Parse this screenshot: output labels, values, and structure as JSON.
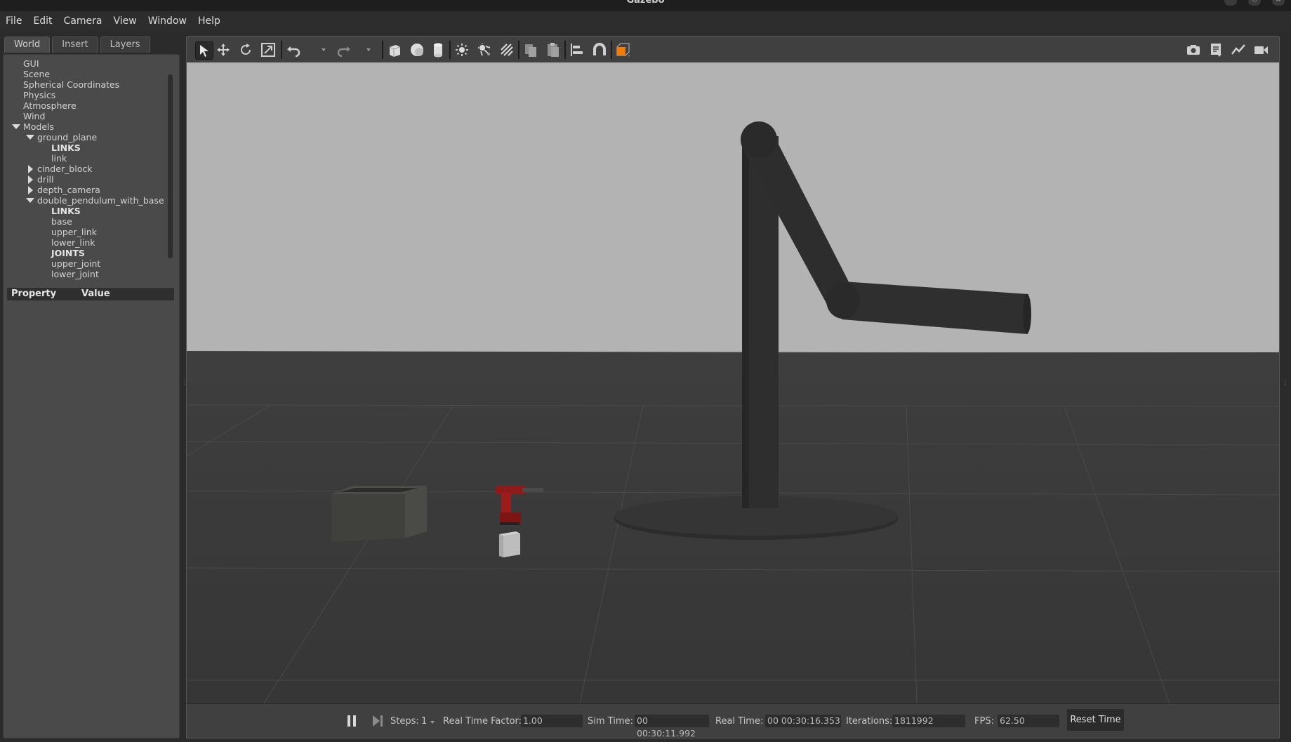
{
  "window": {
    "title": "Gazebo"
  },
  "menubar": [
    "File",
    "Edit",
    "Camera",
    "View",
    "Window",
    "Help"
  ],
  "left_panel": {
    "tabs": [
      {
        "label": "World",
        "active": true
      },
      {
        "label": "Insert",
        "active": false
      },
      {
        "label": "Layers",
        "active": false
      }
    ],
    "tree": [
      {
        "label": "GUI",
        "level": 1,
        "bold": false,
        "arrow": ""
      },
      {
        "label": "Scene",
        "level": 1,
        "bold": false,
        "arrow": ""
      },
      {
        "label": "Spherical Coordinates",
        "level": 1,
        "bold": false,
        "arrow": ""
      },
      {
        "label": "Physics",
        "level": 1,
        "bold": false,
        "arrow": ""
      },
      {
        "label": "Atmosphere",
        "level": 1,
        "bold": false,
        "arrow": ""
      },
      {
        "label": "Wind",
        "level": 1,
        "bold": false,
        "arrow": ""
      },
      {
        "label": "Models",
        "level": 1,
        "bold": false,
        "arrow": "down"
      },
      {
        "label": "ground_plane",
        "level": 2,
        "bold": false,
        "arrow": "down"
      },
      {
        "label": "LINKS",
        "level": 3,
        "bold": true,
        "arrow": ""
      },
      {
        "label": "link",
        "level": 3,
        "bold": false,
        "arrow": ""
      },
      {
        "label": "cinder_block",
        "level": 2,
        "bold": false,
        "arrow": "right"
      },
      {
        "label": "drill",
        "level": 2,
        "bold": false,
        "arrow": "right"
      },
      {
        "label": "depth_camera",
        "level": 2,
        "bold": false,
        "arrow": "right"
      },
      {
        "label": "double_pendulum_with_base",
        "level": 2,
        "bold": false,
        "arrow": "down"
      },
      {
        "label": "LINKS",
        "level": 3,
        "bold": true,
        "arrow": ""
      },
      {
        "label": "base",
        "level": 3,
        "bold": false,
        "arrow": ""
      },
      {
        "label": "upper_link",
        "level": 3,
        "bold": false,
        "arrow": ""
      },
      {
        "label": "lower_link",
        "level": 3,
        "bold": false,
        "arrow": ""
      },
      {
        "label": "JOINTS",
        "level": 3,
        "bold": true,
        "arrow": ""
      },
      {
        "label": "upper_joint",
        "level": 3,
        "bold": false,
        "arrow": ""
      },
      {
        "label": "lower_joint",
        "level": 3,
        "bold": false,
        "arrow": ""
      }
    ],
    "property_header": {
      "property": "Property",
      "value": "Value"
    }
  },
  "toolbar": {
    "left_tools": [
      {
        "name": "select-mode-icon",
        "selected": true
      },
      {
        "name": "translate-mode-icon",
        "selected": false
      },
      {
        "name": "rotate-mode-icon",
        "selected": false
      },
      {
        "name": "scale-mode-icon",
        "selected": false
      },
      {
        "name": "undo-icon",
        "selected": false
      },
      {
        "name": "redo-icon",
        "selected": false
      },
      {
        "name": "box-shape-icon",
        "selected": false
      },
      {
        "name": "sphere-shape-icon",
        "selected": false
      },
      {
        "name": "cylinder-shape-icon",
        "selected": false
      },
      {
        "name": "point-light-icon",
        "selected": false
      },
      {
        "name": "spot-light-icon",
        "selected": false
      },
      {
        "name": "directional-light-icon",
        "selected": false
      },
      {
        "name": "copy-icon",
        "selected": false
      },
      {
        "name": "paste-icon",
        "selected": false
      },
      {
        "name": "align-icon",
        "selected": false
      },
      {
        "name": "snap-icon",
        "selected": false
      },
      {
        "name": "change-view-icon",
        "selected": false
      }
    ],
    "right_tools": [
      "screenshot-icon",
      "log-icon",
      "plot-icon",
      "video-record-icon"
    ]
  },
  "bottom_bar": {
    "steps_label": "Steps:",
    "steps_value": "1",
    "rtf_label": "Real Time Factor:",
    "rtf_value": "1.00",
    "sim_time_label": "Sim Time:",
    "sim_time_value": "00 00:30:11.992",
    "real_time_label": "Real Time:",
    "real_time_value": "00 00:30:16.353",
    "iterations_label": "Iterations:",
    "iterations_value": "1811992",
    "fps_label": "FPS:",
    "fps_value": "62.50",
    "reset_label": "Reset Time"
  },
  "colors": {
    "sky": "#b3b3b3",
    "ground": "#3a3a3a",
    "pendulum": "#2f2f2f",
    "drill_red": "#9b1c1c",
    "orange_accent": "#f57c00"
  }
}
